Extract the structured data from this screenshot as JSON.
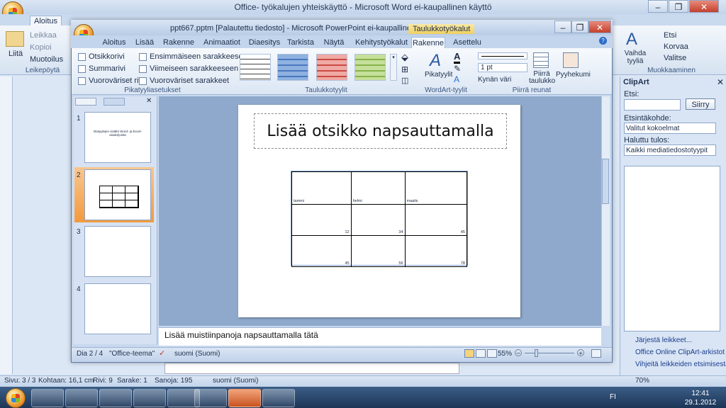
{
  "word": {
    "title": "Office- työkalujen yhteiskäyttö - Microsoft Word ei-kaupallinen käyttö",
    "tabs": [
      "Aloitus"
    ],
    "clipboard": {
      "cut": "Leikkaa",
      "copy": "Kopioi",
      "paste": "Liitä",
      "format_painter": "Muotoilus",
      "group": "Leikepöytä"
    },
    "styles_change": "Vaihda tyyliä",
    "editing": {
      "find": "Etsi",
      "replace": "Korvaa",
      "select": "Valitse",
      "group": "Muokkaaminen"
    },
    "status": {
      "page": "Sivu: 3 / 3",
      "position": "Kohtaan: 16,1 cm",
      "line": "Rivi: 9",
      "column": "Sarake: 1",
      "words": "Sanoja: 195",
      "language": "suomi (Suomi)",
      "zoom": "70%"
    }
  },
  "clipart": {
    "title": "ClipArt",
    "search_label": "Etsi:",
    "go_button": "Siirry",
    "target_label": "Etsintäkohde:",
    "target_value": "Valitut kokoelmat",
    "result_label": "Haluttu tulos:",
    "result_value": "Kaikki mediatiedostotyypit",
    "links": [
      "Järjestä leikkeet...",
      "Office Online ClipArt-arkistot",
      "Vihjeitä leikkeiden etsimisestä"
    ]
  },
  "ppt": {
    "title": "ppt667.pptm [Palautettu tiedosto] - Microsoft PowerPoint ei-kaupallinen käyttö",
    "context_tab": "Taulukkotyökalut",
    "tabs": [
      "Aloitus",
      "Lisää",
      "Rakenne",
      "Animaatiot",
      "Diaesitys",
      "Tarkista",
      "Näytä",
      "Kehitystyökalut",
      "Rakenne",
      "Asettelu"
    ],
    "style_options": {
      "items": [
        "Otsikkorivi",
        "Summarivi",
        "Vuoroväriset rivit",
        "Ensimmäiseen sarakkeeseen",
        "Viimeiseen sarakkeeseen",
        "Vuoroväriset sarakkeet"
      ],
      "group": "Pikatyyliasetukset"
    },
    "table_styles_group": "Taulukkotyylit",
    "wordart": {
      "quick": "Pikatyylit",
      "group": "WordArt-tyylit"
    },
    "borders": {
      "weight": "1 pt",
      "pen_color": "Kynän väri",
      "draw": "Piirrä taulukko",
      "eraser": "Pyyhekumi",
      "group": "Piirrä reunat"
    },
    "slide_numbers": [
      "1",
      "2",
      "3",
      "4"
    ],
    "slide1_text": "Diatyylejen sisältö Word- ja Excel-asiakirjoista",
    "slide_title": "Lisää otsikko napsauttamalla",
    "table": {
      "rows": [
        [
          "tammi",
          "helmi",
          "maalis"
        ],
        [
          "12",
          "34",
          "45"
        ],
        [
          "45",
          "56",
          "78"
        ]
      ]
    },
    "notes": "Lisää muistiinpanoja napsauttamalla tätä",
    "status": {
      "slide": "Dia 2 / 4",
      "theme": "\"Office-teema\"",
      "language": "suomi (Suomi)",
      "zoom": "55%"
    }
  },
  "taskbar": {
    "language": "FI",
    "time": "12:41",
    "date": "29.1.2012"
  }
}
